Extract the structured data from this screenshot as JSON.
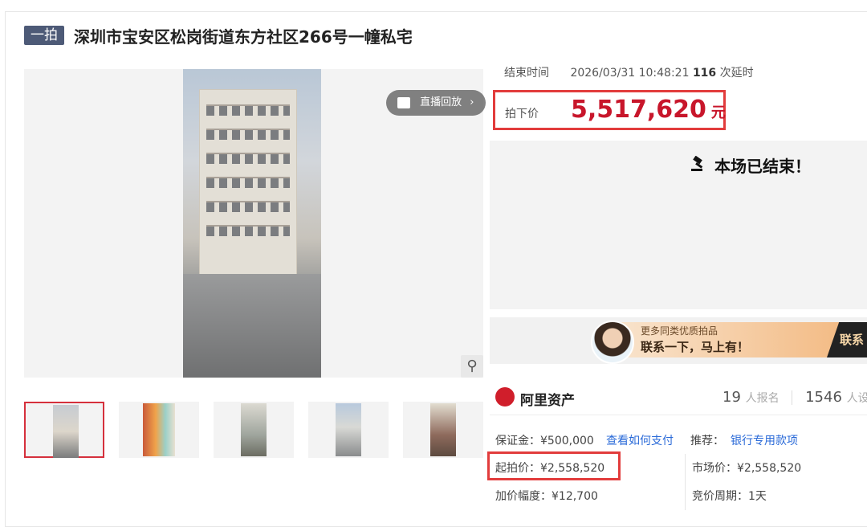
{
  "header": {
    "badge": "一拍",
    "title": "深圳市宝安区松岗街道东方社区266号一幢私宅"
  },
  "gallery": {
    "replay_label": "直播回放",
    "replay_chevron": "›",
    "zoom_icon": "search-icon",
    "thumbnail_count": 5,
    "active_thumbnail": 1
  },
  "auction": {
    "end_label": "结束时间",
    "end_time": "2026/03/31 10:48:21",
    "delay_count": "116",
    "delay_label": "次延时",
    "price_label": "拍下价",
    "price_value": "5,517,620",
    "price_unit": "元",
    "ended_text": "本场已结束！"
  },
  "banner": {
    "line1": "更多同类优质拍品",
    "line2": "联系一下，马上有！",
    "cta": "联系"
  },
  "platform": {
    "name": "阿里资产",
    "registrations": "19",
    "registrations_label": "人报名",
    "reminders": "1546",
    "reminders_label": "人设"
  },
  "details": {
    "deposit": "保证金：¥500,000",
    "how_to_pay": "查看如何支付",
    "recommend_label": "推荐：",
    "recommend_link": "银行专用款项",
    "start_price": "起拍价：¥2,558,520",
    "market_price": "市场价：¥2,558,520",
    "increment": "加价幅度：¥12,700",
    "cycle": "竞价周期：1天"
  },
  "colors": {
    "accent_red": "#c8162b",
    "highlight_border": "#e23c3c",
    "badge_bg": "#4d5a77",
    "link_blue": "#2a6ad8"
  }
}
